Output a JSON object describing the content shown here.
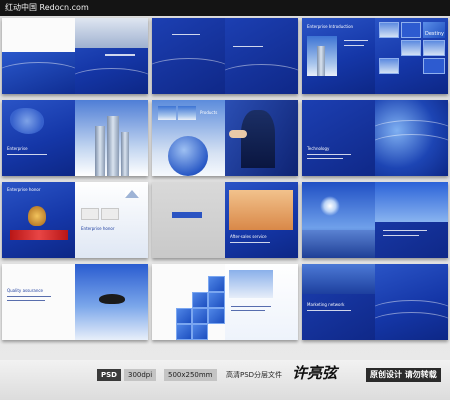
{
  "header": {
    "site_label": "红动中国 Redocn.com"
  },
  "pages": {
    "r1c1_caption": "",
    "r1c3_title": "Enterprise Introduction",
    "r1c3_logo": "Destiny",
    "r2c1_caption": "Enterprise",
    "r2c2_caption": "Products",
    "r2c3_caption": "Technology",
    "r3c1_caption": "Enterprise honor",
    "r3c2_caption": "Enterprise honor",
    "r3c3_caption": "After-sales service",
    "r4c1_caption": "Quality assurance",
    "r4c3_caption": "Marketing network"
  },
  "footer": {
    "format": "PSD",
    "dpi": "300dpi",
    "size": "500x250mm",
    "note": "高清PSD分层文件",
    "signature": "许亮弦",
    "brand": "原创设计 请勿转载"
  },
  "colors": {
    "brand_blue": "#1537a8",
    "topbar": "#141414"
  }
}
